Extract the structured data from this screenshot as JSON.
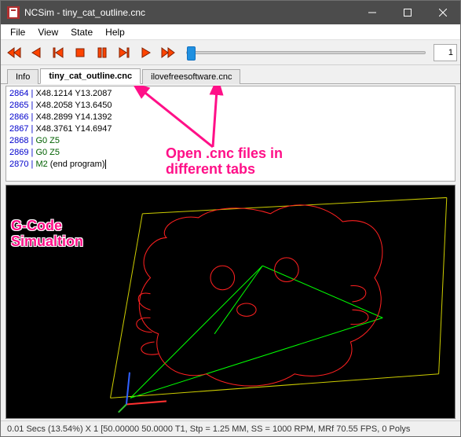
{
  "window": {
    "title": "NCSim - tiny_cat_outline.cnc"
  },
  "menu": {
    "items": [
      "File",
      "View",
      "State",
      "Help"
    ]
  },
  "toolbar": {
    "spin_value": "1"
  },
  "tabs": {
    "items": [
      {
        "label": "Info",
        "active": false
      },
      {
        "label": "tiny_cat_outline.cnc",
        "active": true
      },
      {
        "label": "ilovefreesoftware.cnc",
        "active": false
      }
    ]
  },
  "code": {
    "lines": [
      {
        "num": "2864",
        "cmd": "",
        "xy": "X48.1214 Y13.2087"
      },
      {
        "num": "2865",
        "cmd": "",
        "xy": "X48.2058 Y13.6450"
      },
      {
        "num": "2866",
        "cmd": "",
        "xy": "X48.2899 Y14.1392"
      },
      {
        "num": "2867",
        "cmd": "",
        "xy": "X48.3761 Y14.6947"
      },
      {
        "num": "2868",
        "cmd": "G0 Z5",
        "xy": ""
      },
      {
        "num": "2869",
        "cmd": "G0 Z5",
        "xy": ""
      },
      {
        "num": "2870",
        "cmd": "M2",
        "xy": "(end program)"
      }
    ]
  },
  "annotations": {
    "sim": "G-Code\nSimualtion",
    "tabs_note": "Open .cnc files in\ndifferent tabs"
  },
  "status": {
    "text": "0.01 Secs (13.54%) X 1 [50.00000 50.0000 T1, Stp = 1.25 MM, SS = 1000 RPM, MRf 70.55 FPS, 0 Polys"
  }
}
